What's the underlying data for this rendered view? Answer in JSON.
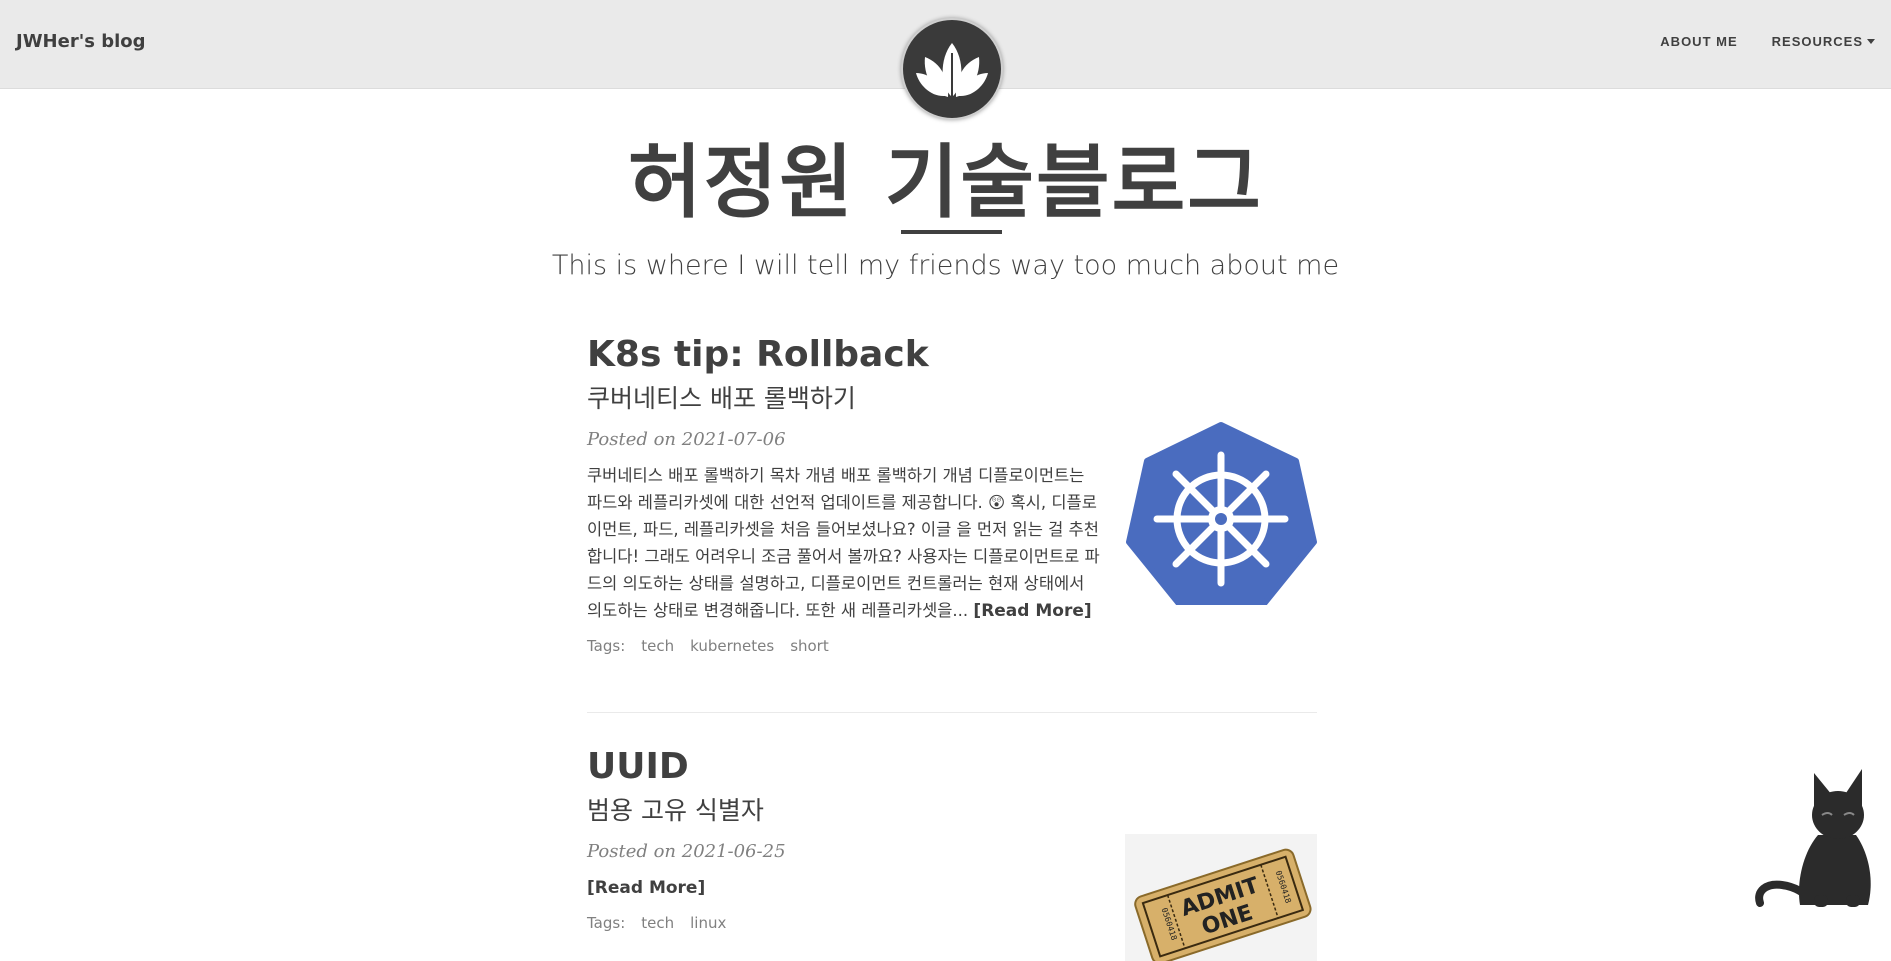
{
  "navbar": {
    "brand": "JWHer's blog",
    "links": [
      {
        "label": "ABOUT ME"
      },
      {
        "label": "RESOURCES"
      }
    ]
  },
  "header": {
    "title": "허정원 기술블로그",
    "subtitle": "This is where I will tell my friends way too much about me"
  },
  "posts": [
    {
      "title": "K8s tip: Rollback",
      "subtitle": "쿠버네티스 배포 롤백하기",
      "meta": "Posted on 2021-07-06",
      "excerpt": "쿠버네티스 배포 롤백하기 목차 개념 배포 롤백하기 개념 디플로이먼트는 파드와 레플리카셋에 대한 선언적 업데이트를 제공합니다. 😲 혹시, 디플로이먼트, 파드, 레플리카셋을 처음 들어보셨나요? 이글 을 먼저 읽는 걸 추천합니다! 그래도 어려우니 조금 풀어서 볼까요? 사용자는 디플로이먼트로 파드의 의도하는 상태를 설명하고, 디플로이먼트 컨트롤러는 현재 상태에서 의도하는 상태로 변경해줍니다. 또한 새 레플리카셋을...",
      "read_more": "[Read More]",
      "tags_label": "Tags:",
      "tags": [
        "tech",
        "kubernetes",
        "short"
      ],
      "image": "kubernetes-logo"
    },
    {
      "title": "UUID",
      "subtitle": "범용 고유 식별자",
      "meta": "Posted on 2021-06-25",
      "read_more": "[Read More]",
      "tags_label": "Tags:",
      "tags": [
        "tech",
        "linux"
      ],
      "image": "admit-one-ticket",
      "image_text": {
        "line1": "ADMIT",
        "line2": "ONE",
        "serial": "0560418"
      }
    }
  ],
  "colors": {
    "navbar_bg": "#eaeaea",
    "text": "#404040",
    "meta": "#808080",
    "k8s_blue": "#4a6cbf",
    "ticket_tan": "#d7b06a"
  }
}
